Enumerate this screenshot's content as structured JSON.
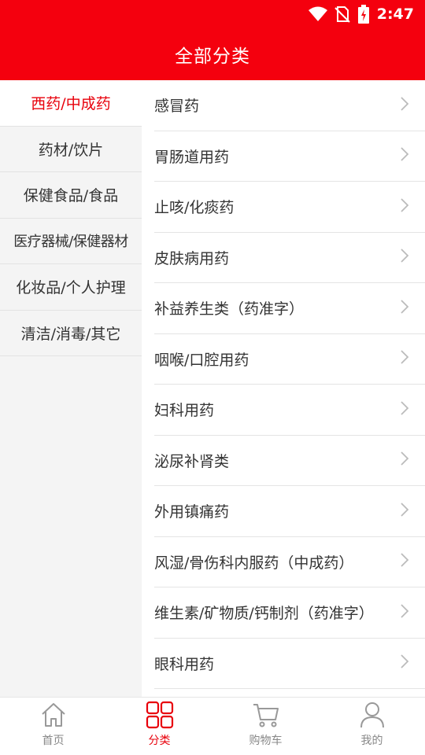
{
  "status_bar": {
    "time": "2:47",
    "icons": [
      "wifi-icon",
      "no-sim-icon",
      "battery-charging-icon"
    ]
  },
  "header": {
    "title": "全部分类"
  },
  "sidebar": {
    "items": [
      {
        "label": "西药/中成药",
        "active": true
      },
      {
        "label": "药材/饮片",
        "active": false
      },
      {
        "label": "保健食品/食品",
        "active": false
      },
      {
        "label": "医疗器械/保健器材",
        "active": false
      },
      {
        "label": "化妆品/个人护理",
        "active": false
      },
      {
        "label": "清洁/消毒/其它",
        "active": false
      }
    ]
  },
  "categories": [
    {
      "label": "感冒药"
    },
    {
      "label": "胃肠道用药"
    },
    {
      "label": "止咳/化痰药"
    },
    {
      "label": "皮肤病用药"
    },
    {
      "label": "补益养生类（药准字）"
    },
    {
      "label": "咽喉/口腔用药"
    },
    {
      "label": "妇科用药"
    },
    {
      "label": "泌尿补肾类"
    },
    {
      "label": "外用镇痛药"
    },
    {
      "label": "风湿/骨伤科内服药（中成药）"
    },
    {
      "label": "维生素/矿物质/钙制剂（药准字）"
    },
    {
      "label": "眼科用药"
    }
  ],
  "tabbar": {
    "tabs": [
      {
        "label": "首页",
        "icon": "home-icon",
        "active": false
      },
      {
        "label": "分类",
        "icon": "category-grid-icon",
        "active": true
      },
      {
        "label": "购物车",
        "icon": "cart-icon",
        "active": false
      },
      {
        "label": "我的",
        "icon": "profile-icon",
        "active": false
      }
    ]
  },
  "colors": {
    "brand_red": "#f4000e",
    "active_text": "#e8000b",
    "sidebar_bg": "#f4f4f4"
  }
}
